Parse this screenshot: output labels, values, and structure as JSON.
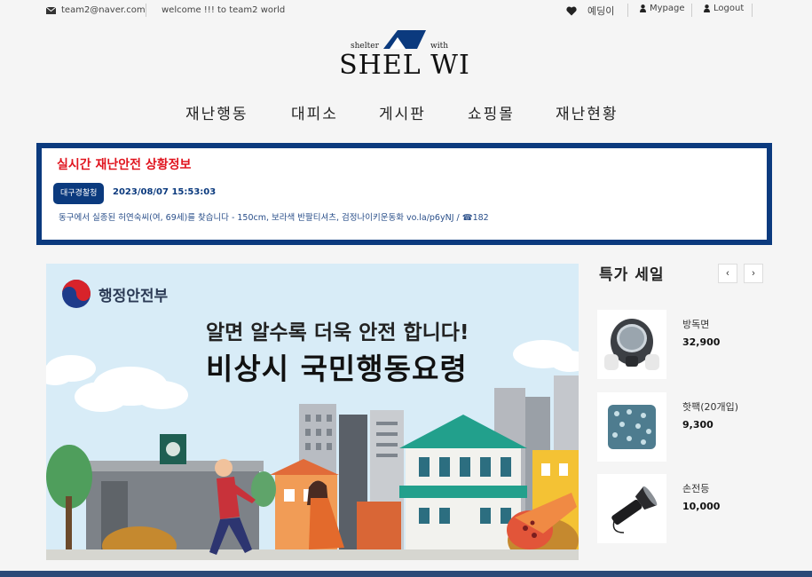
{
  "topbar": {
    "email": "team2@naver.com",
    "welcome": "welcome !!! to team2 world",
    "user_name": "예딩이",
    "mypage": "Mypage",
    "logout": "Logout"
  },
  "logo": {
    "tag_left": "shelter",
    "tag_right": "with",
    "wordmark": "SHEL WI"
  },
  "nav": {
    "items": [
      "재난행동",
      "대피소",
      "게시판",
      "쇼핑몰",
      "재난현황"
    ]
  },
  "alert": {
    "title": "실시간 재난안전 상황정보",
    "source_badge": "대구경찰청",
    "timestamp": "2023/08/07 15:53:03",
    "message": "동구에서 실종된 허연숙씨(여, 69세)를 찾습니다 - 150cm, 보라색 반팔티셔츠, 검정나이키운동화 vo.la/p6yNJ / ☎182"
  },
  "banner": {
    "ministry": "행정안전부",
    "line1": "알면 알수록 더욱 안전 합니다!",
    "line2": "비상시 국민행동요령"
  },
  "sale": {
    "title": "특가 세일",
    "prev_icon": "chevron-left-icon",
    "next_icon": "chevron-right-icon",
    "prev_glyph": "‹",
    "next_glyph": "›",
    "products": [
      {
        "name": "방독면",
        "price": "32,900",
        "icon": "gas-mask-icon"
      },
      {
        "name": "핫팩(20개입)",
        "price": "9,300",
        "icon": "hot-pack-icon"
      },
      {
        "name": "손전등",
        "price": "10,000",
        "icon": "flashlight-icon"
      }
    ]
  },
  "colors": {
    "accent_navy": "#0b3a7e",
    "alert_red": "#e0141e",
    "banner_sky": "#d8ecf7"
  }
}
